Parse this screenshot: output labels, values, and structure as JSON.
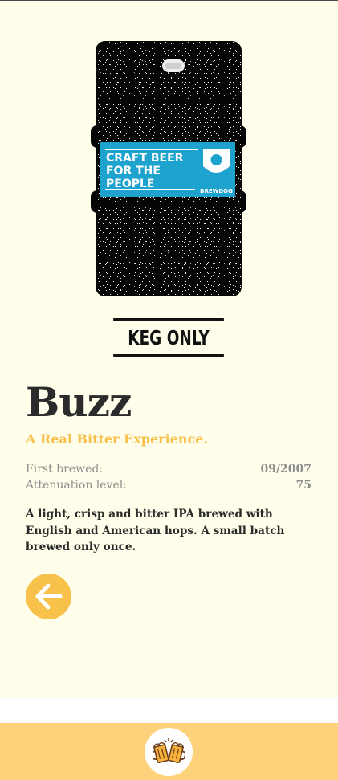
{
  "beer": {
    "keg_badge": "KEG ONLY",
    "keg_label": {
      "line1": "CRAFT BEER",
      "line2": "FOR THE",
      "line3": "PEOPLE",
      "brand": "BREWDOG"
    },
    "name": "Buzz",
    "tagline": "A Real Bitter Experience.",
    "first_brewed_label": "First brewed:",
    "first_brewed_value": "09/2007",
    "attenuation_label": "Attenuation level:",
    "attenuation_value": "75",
    "description": "A light, crisp and bitter IPA brewed with English and American hops. A small batch brewed only once."
  },
  "nav": {
    "back_icon": "arrow-left-icon",
    "home_icon": "beer-mugs-icon"
  },
  "colors": {
    "card_bg": "#fefeea",
    "accent": "#f6c04c",
    "bottom_bar": "#fdd27a",
    "label_blue": "#1ea3cf"
  }
}
